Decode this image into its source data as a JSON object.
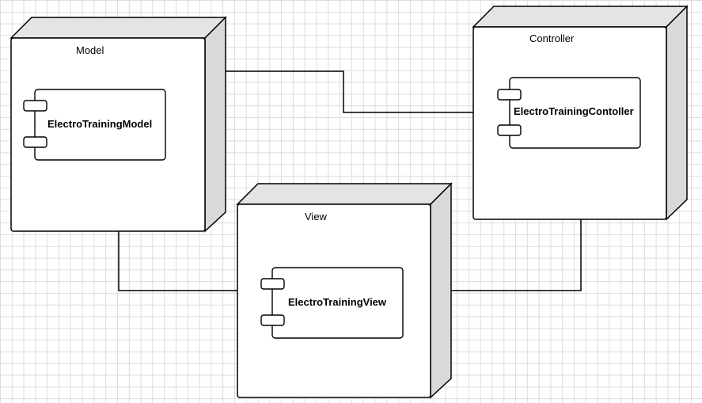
{
  "diagram": {
    "nodes": [
      {
        "id": "model",
        "title": "Model",
        "component": "ElectroTrainingModel"
      },
      {
        "id": "controller",
        "title": "Controller",
        "component": "ElectroTrainingContoller"
      },
      {
        "id": "view",
        "title": "View",
        "component": "ElectroTrainingView"
      }
    ],
    "connections": [
      {
        "from": "model",
        "to": "controller"
      },
      {
        "from": "model",
        "to": "view"
      },
      {
        "from": "controller",
        "to": "view"
      }
    ]
  }
}
